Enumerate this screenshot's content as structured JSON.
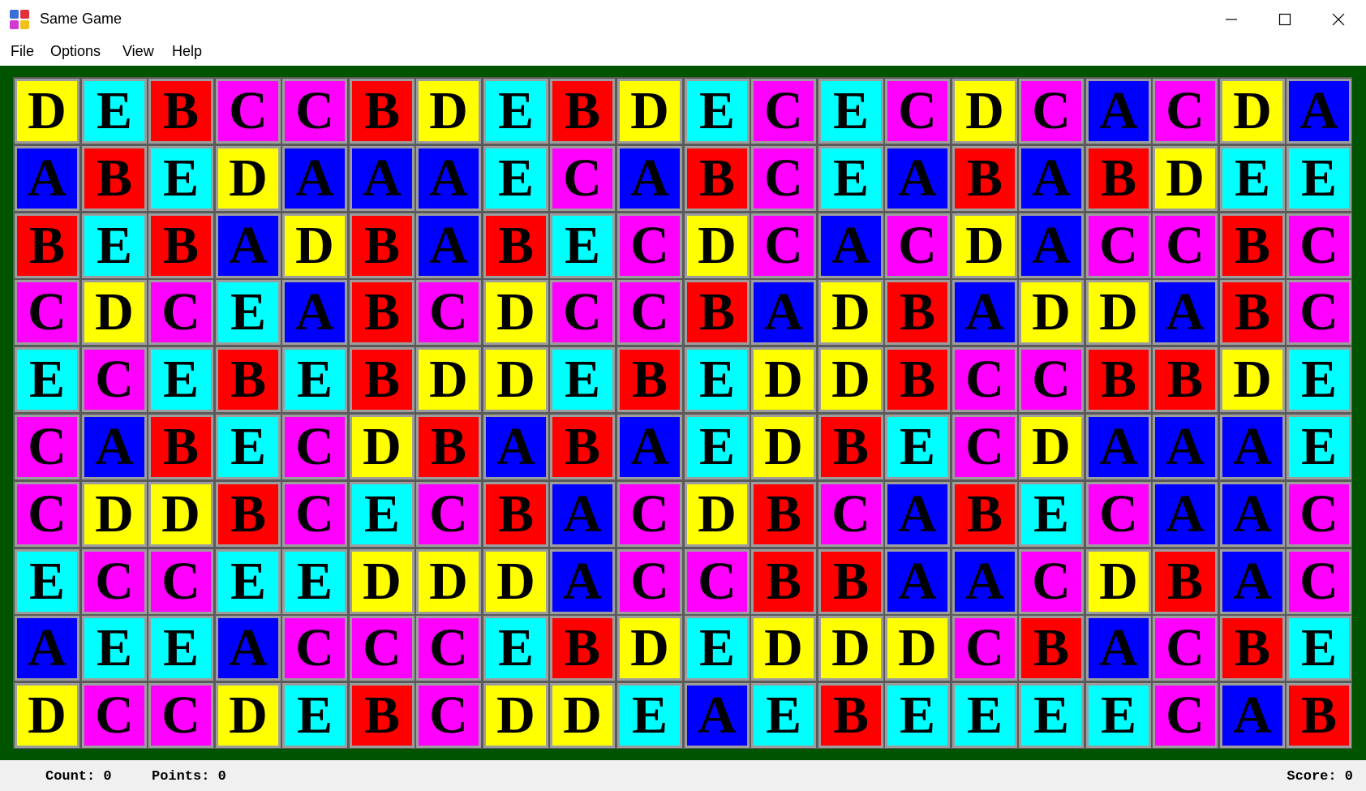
{
  "window": {
    "title": "Same Game",
    "app_icon": "same-game-icon",
    "controls": [
      "minimize-icon",
      "maximize-icon",
      "close-icon"
    ]
  },
  "menu": {
    "items": [
      "File",
      "Options",
      "View",
      "Help"
    ]
  },
  "board": {
    "colors": {
      "A": "#0000ff",
      "B": "#ff0000",
      "C": "#ff00ff",
      "D": "#ffff00",
      "E": "#00ffff"
    },
    "background": "#005400",
    "rows": [
      [
        "D",
        "E",
        "B",
        "C",
        "C",
        "B",
        "D",
        "E",
        "B",
        "D",
        "E",
        "C",
        "E",
        "C",
        "D",
        "C",
        "A",
        "C",
        "D",
        "A"
      ],
      [
        "A",
        "B",
        "E",
        "D",
        "A",
        "A",
        "A",
        "E",
        "C",
        "A",
        "B",
        "C",
        "E",
        "A",
        "B",
        "A",
        "B",
        "D",
        "E",
        "E"
      ],
      [
        "B",
        "E",
        "B",
        "A",
        "D",
        "B",
        "A",
        "B",
        "E",
        "C",
        "D",
        "C",
        "A",
        "C",
        "D",
        "A",
        "C",
        "C",
        "B",
        "C"
      ],
      [
        "C",
        "D",
        "C",
        "E",
        "A",
        "B",
        "C",
        "D",
        "C",
        "C",
        "B",
        "A",
        "D",
        "B",
        "A",
        "D",
        "D",
        "A",
        "B",
        "C"
      ],
      [
        "E",
        "C",
        "E",
        "B",
        "E",
        "B",
        "D",
        "D",
        "E",
        "B",
        "E",
        "D",
        "D",
        "B",
        "C",
        "C",
        "B",
        "B",
        "D",
        "E"
      ],
      [
        "C",
        "A",
        "B",
        "E",
        "C",
        "D",
        "B",
        "A",
        "B",
        "A",
        "E",
        "D",
        "B",
        "E",
        "C",
        "D",
        "A",
        "A",
        "A",
        "E"
      ],
      [
        "C",
        "D",
        "D",
        "B",
        "C",
        "E",
        "C",
        "B",
        "A",
        "C",
        "D",
        "B",
        "C",
        "A",
        "B",
        "E",
        "C",
        "A",
        "A",
        "C"
      ],
      [
        "E",
        "C",
        "C",
        "E",
        "E",
        "D",
        "D",
        "D",
        "A",
        "C",
        "C",
        "B",
        "B",
        "A",
        "A",
        "C",
        "D",
        "B",
        "A",
        "C"
      ],
      [
        "A",
        "E",
        "E",
        "A",
        "C",
        "C",
        "C",
        "E",
        "B",
        "D",
        "E",
        "D",
        "D",
        "D",
        "C",
        "B",
        "A",
        "C",
        "B",
        "E"
      ],
      [
        "D",
        "C",
        "C",
        "D",
        "E",
        "B",
        "C",
        "D",
        "D",
        "E",
        "A",
        "E",
        "B",
        "E",
        "E",
        "E",
        "E",
        "C",
        "A",
        "B"
      ]
    ]
  },
  "status": {
    "count": "Count: 0",
    "points": "Points: 0",
    "score": "Score: 0"
  }
}
